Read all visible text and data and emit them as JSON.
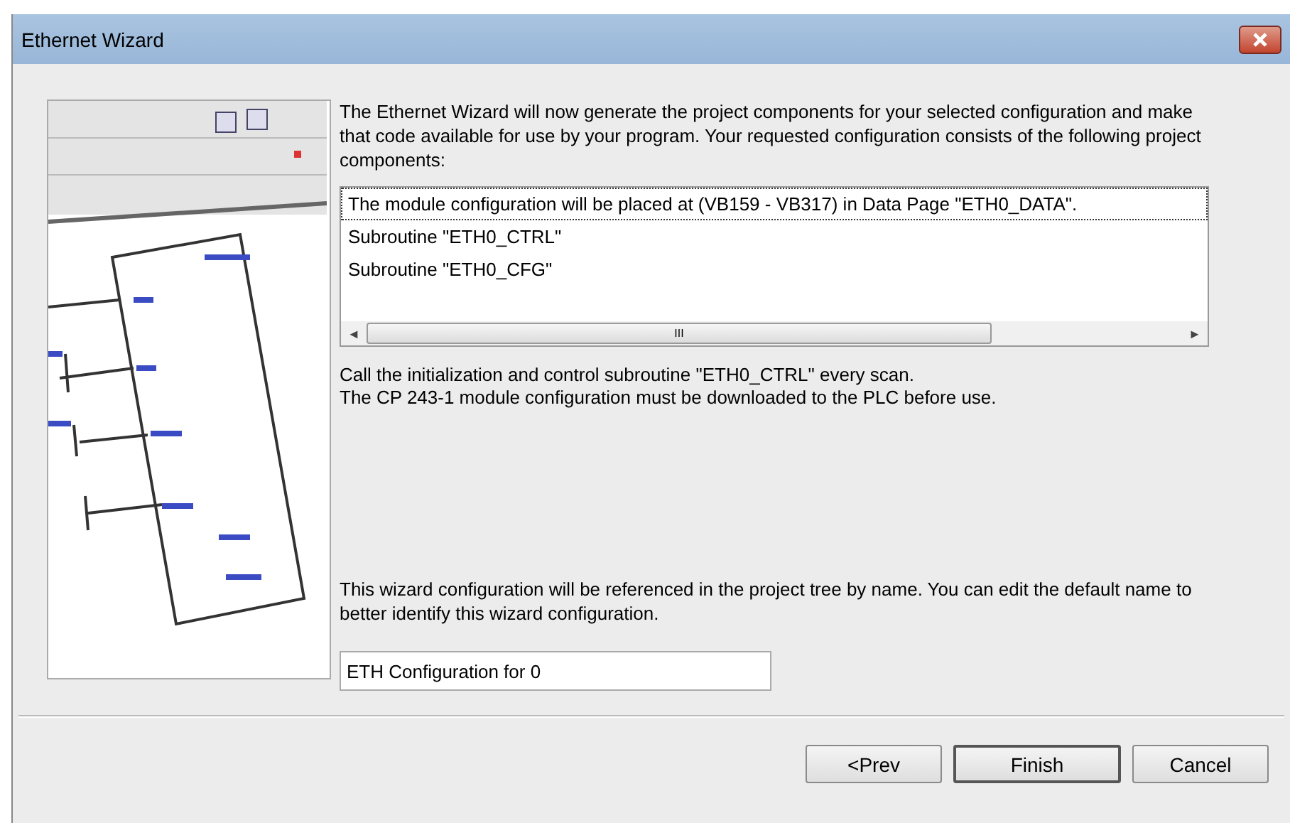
{
  "window": {
    "title": "Ethernet Wizard"
  },
  "intro": "The Ethernet Wizard will now generate the project components for your selected configuration and make that code available for use by your program. Your requested configuration consists of the following project components:",
  "components": [
    {
      "label": "The module configuration will be placed at (VB159 - VB317) in Data Page \"ETH0_DATA\".",
      "selected": true
    },
    {
      "label": "Subroutine \"ETH0_CTRL\"",
      "selected": false
    },
    {
      "label": "Subroutine \"ETH0_CFG\"",
      "selected": false
    }
  ],
  "scroll_left": "◄",
  "scroll_grip": "III",
  "scroll_right": "►",
  "notes": [
    "Call the initialization and control subroutine \"ETH0_CTRL\" every scan.",
    "The CP 243-1  module configuration must be downloaded to the PLC before use."
  ],
  "name_hint": "This wizard configuration will be referenced in the project tree by name. You can edit the default name to better identify this wizard configuration.",
  "name_field": {
    "value": "ETH Configuration for 0"
  },
  "buttons": [
    {
      "label": "<Prev",
      "kind": "normal"
    },
    {
      "label": "Finish",
      "kind": "default"
    },
    {
      "label": "Cancel",
      "kind": "normal"
    }
  ]
}
